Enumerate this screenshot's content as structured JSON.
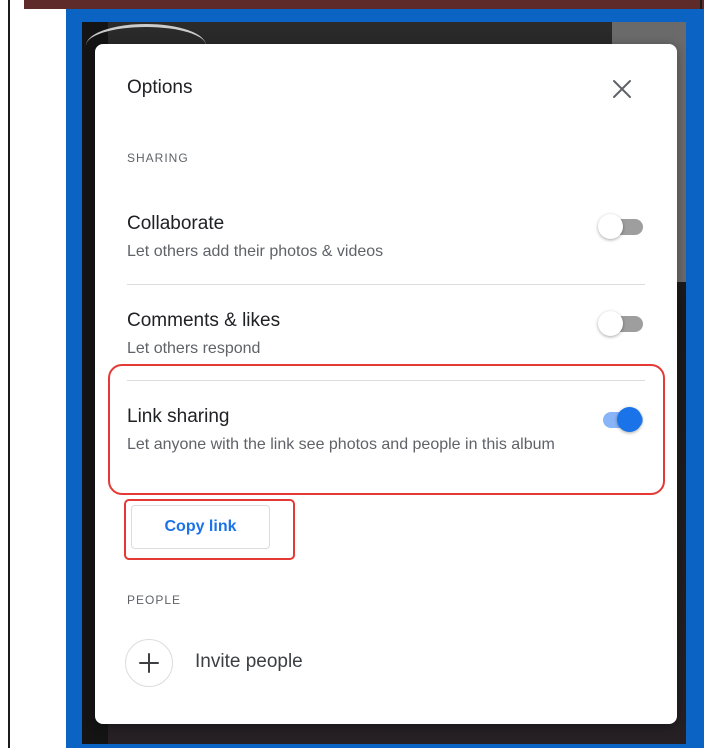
{
  "dialog": {
    "title": "Options",
    "close_icon": "close-icon"
  },
  "sharing": {
    "section_label": "SHARING",
    "options": [
      {
        "title": "Collaborate",
        "description": "Let others add their photos & videos",
        "enabled": false
      },
      {
        "title": "Comments & likes",
        "description": "Let others respond",
        "enabled": false
      },
      {
        "title": "Link sharing",
        "description": "Let anyone with the link see photos and people in this album",
        "enabled": true
      }
    ],
    "copy_link_label": "Copy link"
  },
  "people": {
    "section_label": "PEOPLE",
    "invite_icon": "plus-icon",
    "invite_label": "Invite people"
  },
  "colors": {
    "accent": "#1a73e8",
    "toggle_on_track": "#8ab4f8",
    "toggle_off_track": "#9e9e9e",
    "highlight": "#e53935",
    "frame": "#0b63c4"
  }
}
